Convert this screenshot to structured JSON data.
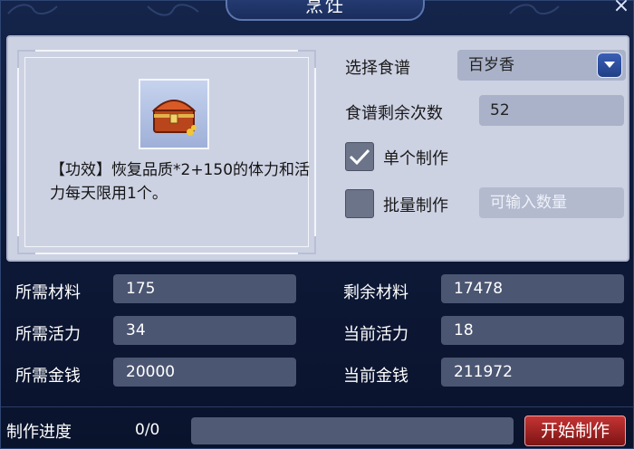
{
  "window": {
    "title": "烹饪",
    "close_glyph": "×"
  },
  "item": {
    "icon": "treasure-chest-icon",
    "description": "【功效】恢复品质*2+150的体力和活力每天限用1个。"
  },
  "recipe": {
    "select_label": "选择食谱",
    "selected": "百岁香",
    "remaining_label": "食谱剩余次数",
    "remaining_value": "52",
    "single_label": "单个制作",
    "single_checked": true,
    "batch_label": "批量制作",
    "batch_checked": false,
    "batch_placeholder": "可输入数量"
  },
  "stats": {
    "required_material_label": "所需材料",
    "required_material": "175",
    "remaining_material_label": "剩余材料",
    "remaining_material": "17478",
    "required_vitality_label": "所需活力",
    "required_vitality": "34",
    "current_vitality_label": "当前活力",
    "current_vitality": "18",
    "required_money_label": "所需金钱",
    "required_money": "20000",
    "current_money_label": "当前金钱",
    "current_money": "211972"
  },
  "progress": {
    "label": "制作进度",
    "count": "0/0",
    "fraction": 0
  },
  "start_button": "开始制作",
  "colors": {
    "start_button": "#a82222",
    "panel": "#cdd2e3",
    "field": "#4b5673"
  }
}
